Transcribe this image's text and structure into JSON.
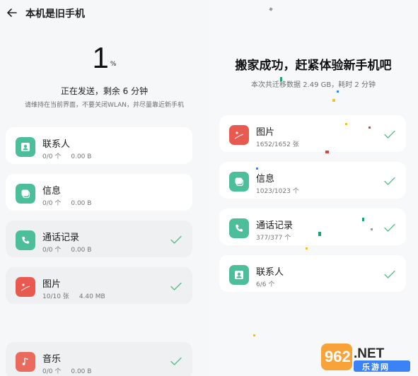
{
  "left": {
    "title": "本机是旧手机",
    "percent_value": "1",
    "percent_sign": "%",
    "status": "正在发送，剩余 6 分钟",
    "hint": "请维持在当前界面，不要关闭WLAN，并尽量靠近新手机",
    "items": [
      {
        "name": "联系人",
        "count": "0/0 个",
        "size": "0.00 B",
        "icon": "contact-icon"
      },
      {
        "name": "信息",
        "count": "0/0 个",
        "size": "0.00 B",
        "icon": "message-icon"
      },
      {
        "name": "通话记录",
        "count": "0/0 个",
        "size": "0.00 B",
        "icon": "phone-icon"
      },
      {
        "name": "图片",
        "count": "10/10 张",
        "size": "4.40 MB",
        "icon": "picture-icon"
      },
      {
        "name": "音乐",
        "count": "0/0 个",
        "size": "0.00 B",
        "icon": "music-icon"
      }
    ]
  },
  "right": {
    "headline": "搬家成功，赶紧体验新手机吧",
    "summary": "本次共迁移数据 2.49 GB，耗时 2 分钟",
    "items": [
      {
        "name": "图片",
        "count": "1652/1652 张",
        "icon": "picture-icon"
      },
      {
        "name": "信息",
        "count": "1023/1023 个",
        "icon": "message-icon"
      },
      {
        "name": "通话记录",
        "count": "377/377 个",
        "icon": "phone-icon"
      },
      {
        "name": "联系人",
        "count": "6/6 个",
        "icon": "contact-icon"
      }
    ]
  },
  "watermark": {
    "logo_text": "962.NET",
    "caption": "乐游网"
  },
  "colors": {
    "green": "#4cbf9a",
    "red": "#e85a4f",
    "check": "#5dbb8a"
  }
}
